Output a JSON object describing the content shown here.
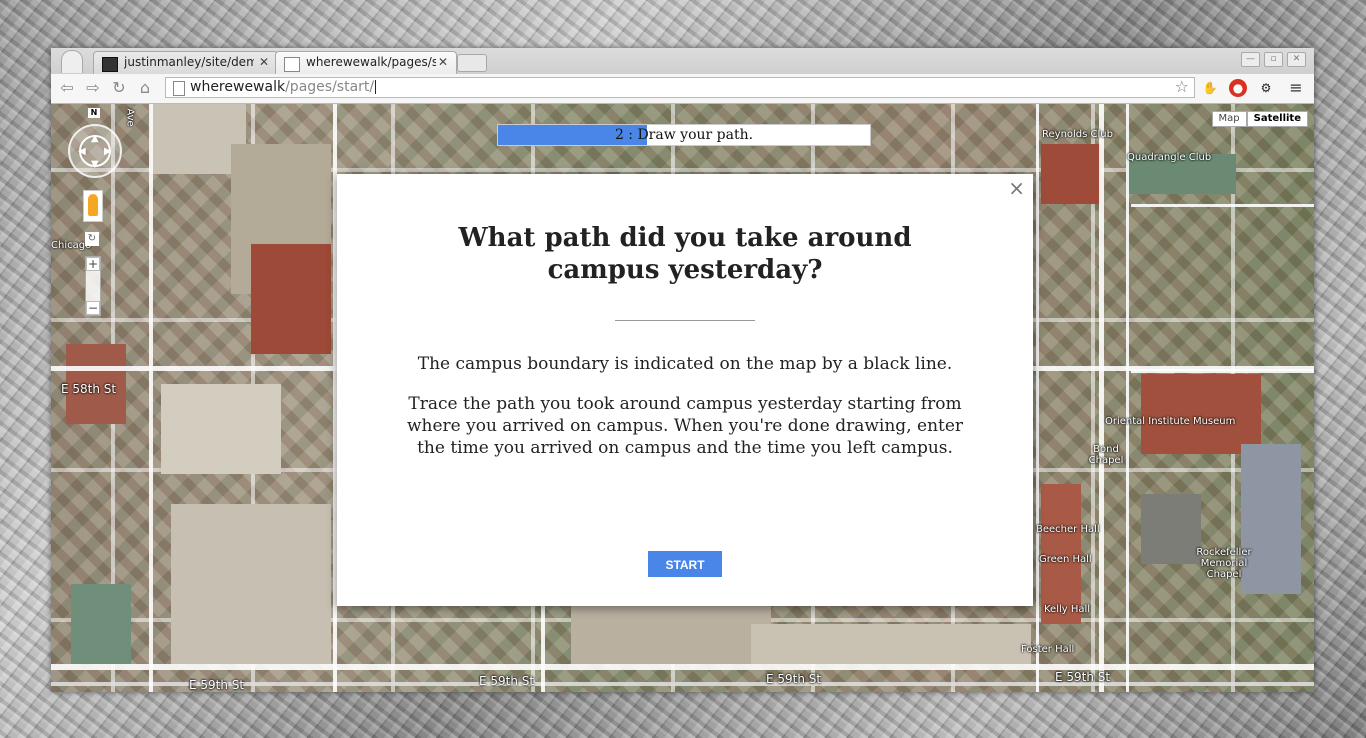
{
  "browser": {
    "tabs": [
      {
        "title": "justinmanley/site/dem",
        "active": false
      },
      {
        "title": "wherewewalk/pages/s",
        "active": true
      }
    ],
    "address": {
      "host": "wherewewalk",
      "path": "/pages/start/"
    }
  },
  "map": {
    "type_buttons": [
      "Map",
      "Satellite"
    ],
    "selected_type": "Satellite",
    "compass_label": "N",
    "labels": {
      "e58": "E 58th St",
      "e59a": "E 59th St",
      "e59b": "E 59th St",
      "e59c": "E 59th St",
      "e59d": "E 59th St",
      "quad": "Quadrangle Club",
      "oriental": "Oriental Institute Museum",
      "rockefeller": "Rockefeller Memorial Chapel",
      "reynolds": "Reynolds Club",
      "green": "Green Hall",
      "beecher": "Beecher Hall",
      "kelly": "Kelly Hall",
      "foster": "Foster Hall",
      "chicago": "Chicago",
      "ave": "Ave",
      "bondchapel": "Bond Chapel"
    }
  },
  "progress": {
    "label": "2 : Draw your path.",
    "fraction": 0.4
  },
  "modal": {
    "title": "What path did you take around campus yesterday?",
    "p1": "The campus boundary is indicated on the map by a black line.",
    "p2": "Trace the path you took around campus yesterday starting from where you arrived on campus. When you're done drawing, enter the time you arrived on campus and the time you left campus.",
    "start_label": "START",
    "close_label": "×"
  }
}
